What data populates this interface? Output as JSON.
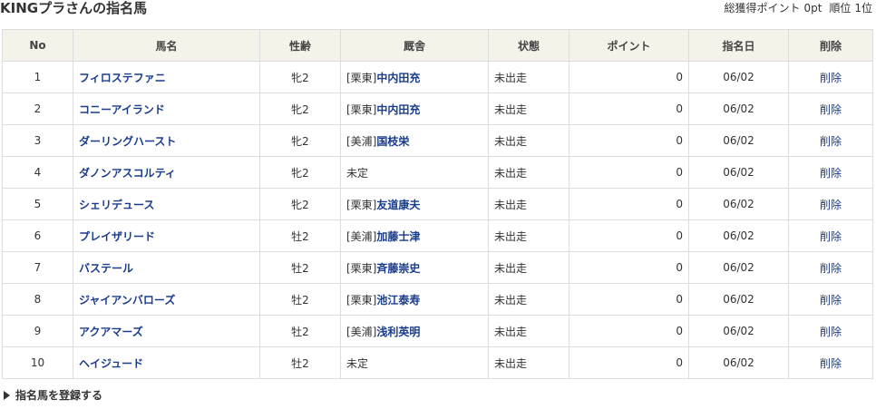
{
  "header": {
    "title": "KINGプラさんの指名馬",
    "total_points_label": "総獲得ポイント",
    "total_points": "0pt",
    "rank_label": "順位",
    "rank": "1位"
  },
  "table": {
    "columns": [
      "No",
      "馬名",
      "性齢",
      "厩舎",
      "状態",
      "ポイント",
      "指名日",
      "削除"
    ],
    "rows": [
      {
        "no": "1",
        "name": "フィロステファニ",
        "sex_age": "牝2",
        "stable_region": "[栗東]",
        "trainer": "中内田充",
        "status": "未出走",
        "points": "0",
        "date": "06/02",
        "delete": "削除"
      },
      {
        "no": "2",
        "name": "コニーアイランド",
        "sex_age": "牝2",
        "stable_region": "[栗東]",
        "trainer": "中内田充",
        "status": "未出走",
        "points": "0",
        "date": "06/02",
        "delete": "削除"
      },
      {
        "no": "3",
        "name": "ダーリングハースト",
        "sex_age": "牝2",
        "stable_region": "[美浦]",
        "trainer": "国枝栄",
        "status": "未出走",
        "points": "0",
        "date": "06/02",
        "delete": "削除"
      },
      {
        "no": "4",
        "name": "ダノンアスコルティ",
        "sex_age": "牝2",
        "stable_region": "未定",
        "trainer": "",
        "status": "未出走",
        "points": "0",
        "date": "06/02",
        "delete": "削除"
      },
      {
        "no": "5",
        "name": "シェリデュース",
        "sex_age": "牝2",
        "stable_region": "[栗東]",
        "trainer": "友道康夫",
        "status": "未出走",
        "points": "0",
        "date": "06/02",
        "delete": "削除"
      },
      {
        "no": "6",
        "name": "プレイザリード",
        "sex_age": "牡2",
        "stable_region": "[美浦]",
        "trainer": "加藤士津",
        "status": "未出走",
        "points": "0",
        "date": "06/02",
        "delete": "削除"
      },
      {
        "no": "7",
        "name": "バステール",
        "sex_age": "牡2",
        "stable_region": "[栗東]",
        "trainer": "斉藤崇史",
        "status": "未出走",
        "points": "0",
        "date": "06/02",
        "delete": "削除"
      },
      {
        "no": "8",
        "name": "ジャイアンバローズ",
        "sex_age": "牡2",
        "stable_region": "[栗東]",
        "trainer": "池江泰寿",
        "status": "未出走",
        "points": "0",
        "date": "06/02",
        "delete": "削除"
      },
      {
        "no": "9",
        "name": "アクアマーズ",
        "sex_age": "牡2",
        "stable_region": "[美浦]",
        "trainer": "浅利英明",
        "status": "未出走",
        "points": "0",
        "date": "06/02",
        "delete": "削除"
      },
      {
        "no": "10",
        "name": "ヘイジュード",
        "sex_age": "牡2",
        "stable_region": "未定",
        "trainer": "",
        "status": "未出走",
        "points": "0",
        "date": "06/02",
        "delete": "削除"
      }
    ]
  },
  "footer": {
    "register_label": "指名馬を登録する",
    "register_icon": "triangle-right-icon"
  }
}
